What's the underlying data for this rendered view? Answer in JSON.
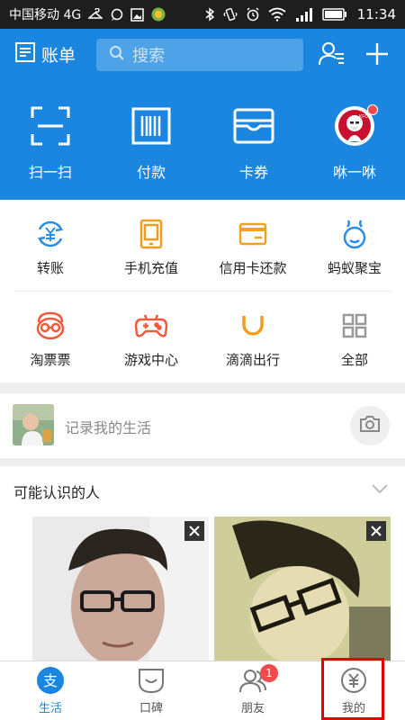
{
  "status_bar": {
    "carrier": "中国移动 4G",
    "time": "11:34"
  },
  "header": {
    "bill_label": "账单",
    "search_placeholder": "搜索"
  },
  "quick_actions": [
    {
      "label": "扫一扫",
      "icon": "scan-icon"
    },
    {
      "label": "付款",
      "icon": "barcode-icon"
    },
    {
      "label": "卡券",
      "icon": "card-wallet-icon"
    },
    {
      "label": "咻一咻",
      "icon": "kfc-logo"
    }
  ],
  "services": [
    {
      "label": "转账",
      "icon": "transfer-icon",
      "color": "#2b8de3"
    },
    {
      "label": "手机充值",
      "icon": "phone-recharge-icon",
      "color": "#f29c20"
    },
    {
      "label": "信用卡还款",
      "icon": "credit-card-icon",
      "color": "#f0a020"
    },
    {
      "label": "蚂蚁聚宝",
      "icon": "ant-fortune-icon",
      "color": "#2b8de3"
    },
    {
      "label": "淘票票",
      "icon": "taopiaopiao-icon",
      "color": "#ef5a3c"
    },
    {
      "label": "游戏中心",
      "icon": "gamepad-icon",
      "color": "#ef5a3c"
    },
    {
      "label": "滴滴出行",
      "icon": "didi-icon",
      "color": "#f29c20"
    },
    {
      "label": "全部",
      "icon": "grid-icon",
      "color": "#999999"
    }
  ],
  "life": {
    "prompt": "记录我的生活"
  },
  "people": {
    "title": "可能认识的人"
  },
  "tabs": [
    {
      "label": "生活",
      "icon": "life-icon",
      "active": true
    },
    {
      "label": "口碑",
      "icon": "koubei-icon",
      "active": false
    },
    {
      "label": "朋友",
      "icon": "friends-icon",
      "active": false,
      "badge": "1"
    },
    {
      "label": "我的",
      "icon": "yuan-coin-icon",
      "active": false
    }
  ],
  "colors": {
    "brand_blue": "#1a86df",
    "badge_red": "#f04a4a",
    "highlight_red": "#e60000"
  }
}
